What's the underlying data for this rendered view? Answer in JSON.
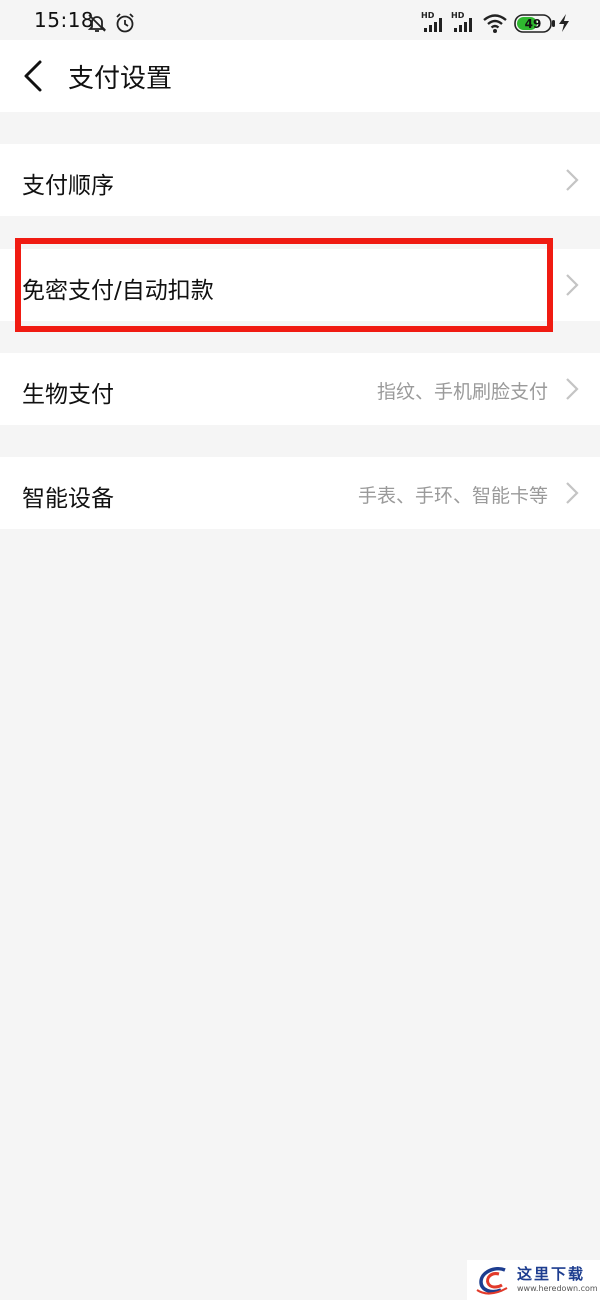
{
  "status_bar": {
    "time": "15:18",
    "battery": "49",
    "icons": [
      "mute-icon",
      "alarm-icon",
      "signal-hd-icon",
      "signal-hd-icon",
      "wifi-icon",
      "battery-icon",
      "charging-icon"
    ],
    "signal_label_1": "HD",
    "signal_label_2": "HD"
  },
  "header": {
    "title": "支付设置",
    "back_icon": "back-arrow-icon"
  },
  "settings": {
    "items": [
      {
        "label": "支付顺序",
        "value": ""
      },
      {
        "label": "免密支付/自动扣款",
        "value": ""
      },
      {
        "label": "生物支付",
        "value": "指纹、手机刷脸支付"
      },
      {
        "label": "智能设备",
        "value": "手表、手环、智能卡等"
      }
    ]
  },
  "annotation": {
    "highlight_color": "#f01b12"
  },
  "watermark": {
    "text": "这里下载",
    "url": "www.heredown.com"
  },
  "colors": {
    "background": "#f5f5f5",
    "card": "#ffffff",
    "secondary_text": "#9a9a9a",
    "chevron": "#c4c4c4",
    "battery_fill": "#2fb82f"
  }
}
